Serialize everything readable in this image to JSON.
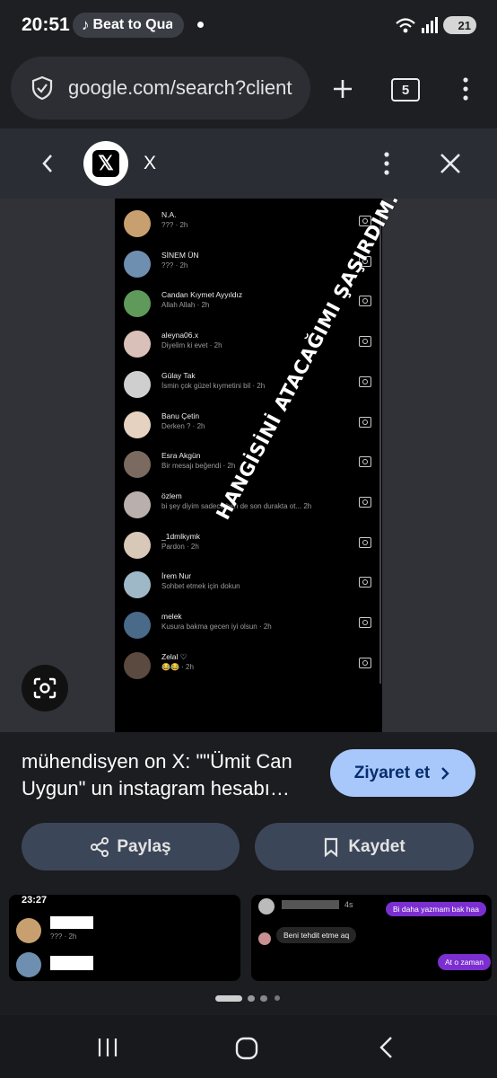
{
  "status": {
    "time": "20:51",
    "media_title": "Beat to Quarter",
    "battery": "21"
  },
  "browser": {
    "url": "google.com/search?client",
    "tab_count": "5"
  },
  "sheet": {
    "site_name": "X"
  },
  "image": {
    "overlay_text": "HANGİSİNİ ATACAĞIMI ŞAŞIRDIM.",
    "rows": [
      {
        "name": "N.A.",
        "sub": "??? · 2h",
        "color": "#c8a070"
      },
      {
        "name": "SİNEM ÜN",
        "sub": "??? · 2h",
        "color": "#6f8fb0"
      },
      {
        "name": "Candan Kıymet Ayyıldız",
        "sub": "Allah Allah · 2h",
        "color": "#5f9a5a"
      },
      {
        "name": "aleyna06.x",
        "sub": "Diyelim ki evet · 2h",
        "color": "#d9c0b8"
      },
      {
        "name": "Gülay Tak",
        "sub": "İsmin çok güzel kıymetini bil · 2h",
        "color": "#cfcfcf"
      },
      {
        "name": "Banu Çetin",
        "sub": "Derken ? · 2h",
        "color": "#e6d2c0"
      },
      {
        "name": "Esra Akgün",
        "sub": "Bir mesajı beğendi · 2h",
        "color": "#7a6a60"
      },
      {
        "name": "özlem",
        "sub": "bi şey diyim sadece ben de son durakta ot... 2h",
        "color": "#b9b0ae"
      },
      {
        "name": "_1dmlkymk",
        "sub": "Pardon · 2h",
        "color": "#d8c8b8"
      },
      {
        "name": "İrem Nur",
        "sub": "Sohbet etmek için dokun",
        "color": "#9fb8c8"
      },
      {
        "name": "melek",
        "sub": "Kusura bakma gecen iyi olsun · 2h",
        "color": "#4a6a8a"
      },
      {
        "name": "Zelal ♡",
        "sub": "😂😂 · 2h",
        "color": "#5a4a40"
      }
    ]
  },
  "result": {
    "title": "mühendisyen on X: \"\"Ümit Can Uygun\" un instagram hesabı…",
    "visit_label": "Ziyaret et",
    "share_label": "Paylaş",
    "save_label": "Kaydet"
  },
  "thumbnails": {
    "left_time": "23:27",
    "left_row1_sub": "??? · 2h",
    "right_bubble1": "Bi daha yazmam bak haa",
    "right_bubble2": "Beni tehdit etme aq",
    "right_bubble3": "At o zaman",
    "right_time": "4s"
  }
}
